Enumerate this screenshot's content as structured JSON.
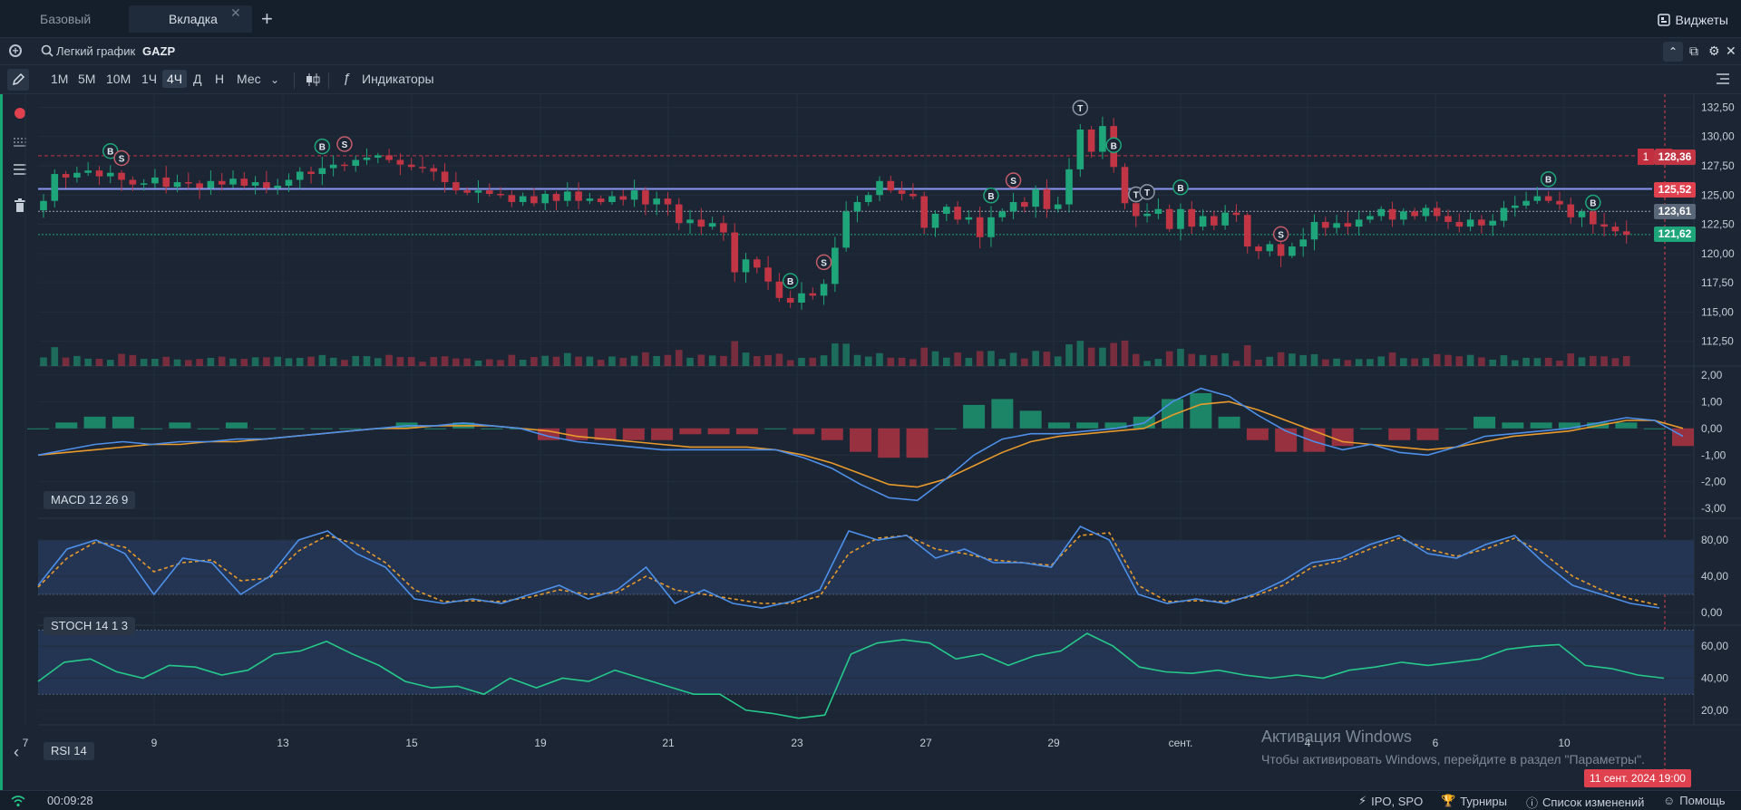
{
  "tabs": [
    {
      "label": "Базовый"
    },
    {
      "label": "Вкладка",
      "active": true
    }
  ],
  "tab_close_glyph": "✕",
  "tab_add_glyph": "+",
  "widgets_label": "Виджеты",
  "search": {
    "chart_type": "Легкий график",
    "ticker": "GAZP"
  },
  "timeframes": [
    "1М",
    "5М",
    "10М",
    "1Ч",
    "4Ч",
    "Д",
    "Н",
    "Мес"
  ],
  "active_timeframe": "4Ч",
  "indicators_label": "Индикаторы",
  "indicator_labels": {
    "macd": "MACD 12 26 9",
    "stoch": "STOCH 14 1 3",
    "rsi": "RSI 14"
  },
  "price_tags": {
    "order": "128,36",
    "level": "125,52",
    "current": "123,61",
    "bid": "121,62"
  },
  "order_qty": "1",
  "date_flag": "11 сент. 2024 19:00",
  "watermark": {
    "title": "Активация Windows",
    "subtitle": "Чтобы активировать Windows, перейдите в раздел \"Параметры\"."
  },
  "status": {
    "clock": "00:09:28",
    "ipo": "IPO, SPO",
    "tournaments": "Турниры",
    "changelog": "Список изменений",
    "help": "Помощь"
  },
  "colors": {
    "up": "#1fa57a",
    "down": "#c23545",
    "macd": "#4e8fe8",
    "signal": "#e89a2c",
    "rsi": "#25c98a",
    "level": "#8a96f0",
    "band": "#233552"
  },
  "chart_data": [
    {
      "type": "candlestick",
      "ticker": "GAZP",
      "x_ticks": [
        "7",
        "9",
        "13",
        "15",
        "19",
        "21",
        "23",
        "27",
        "29",
        "сент.",
        "4",
        "6",
        "10"
      ],
      "y_ticks": [
        "132,50",
        "130,00",
        "127,50",
        "125,00",
        "122,50",
        "120,00",
        "117,50",
        "115,00",
        "112,50"
      ],
      "ylim": [
        111,
        133
      ],
      "close": [
        124.5,
        126.8,
        126.5,
        126.9,
        127.1,
        126.6,
        126.9,
        126.3,
        125.9,
        126.0,
        126.5,
        125.7,
        126.1,
        126.0,
        125.6,
        126.2,
        125.9,
        126.4,
        125.8,
        126.1,
        125.6,
        125.8,
        126.3,
        127.0,
        126.8,
        127.3,
        127.6,
        127.5,
        128.0,
        128.2,
        128.4,
        128.0,
        127.6,
        127.4,
        127.3,
        127.0,
        126.1,
        125.4,
        125.2,
        125.4,
        125.1,
        125.0,
        124.4,
        124.9,
        124.3,
        125.1,
        124.5,
        125.3,
        124.5,
        124.7,
        124.4,
        124.9,
        124.6,
        125.4,
        124.2,
        124.7,
        124.2,
        122.6,
        122.9,
        122.3,
        122.6,
        121.8,
        118.4,
        119.5,
        118.8,
        117.6,
        116.2,
        115.8,
        116.6,
        116.4,
        117.4,
        120.5,
        123.6,
        124.4,
        125.0,
        126.2,
        125.4,
        125.1,
        124.9,
        122.2,
        123.4,
        124.0,
        122.9,
        123.1,
        121.4,
        123.1,
        123.6,
        124.4,
        124.0,
        125.5,
        123.8,
        124.2,
        127.2,
        130.6,
        128.7,
        130.9,
        127.4,
        124.3,
        123.2,
        123.4,
        123.8,
        122.1,
        123.8,
        122.3,
        123.2,
        122.4,
        123.5,
        123.3,
        120.6,
        120.2,
        120.8,
        119.8,
        120.6,
        121.2,
        122.7,
        122.2,
        122.6,
        122.3,
        122.9,
        123.2,
        123.8,
        122.9,
        123.6,
        123.2,
        123.9,
        123.2,
        122.7,
        122.3,
        122.9,
        122.4,
        122.8,
        123.9,
        124.1,
        124.5,
        124.9,
        124.5,
        124.2,
        123.1,
        123.6,
        122.5,
        122.3,
        121.9,
        121.6
      ],
      "volume_shown": true,
      "price_lines": [
        "128,36",
        "125,52",
        "123,61",
        "121,62"
      ],
      "trade_marks": [
        {
          "label": "B",
          "i": 6
        },
        {
          "label": "S",
          "i": 7
        },
        {
          "label": "B",
          "i": 25
        },
        {
          "label": "S",
          "i": 27
        },
        {
          "label": "B",
          "i": 67
        },
        {
          "label": "S",
          "i": 70
        },
        {
          "label": "B",
          "i": 85
        },
        {
          "label": "S",
          "i": 87
        },
        {
          "label": "T",
          "i": 93
        },
        {
          "label": "B",
          "i": 96
        },
        {
          "label": "T",
          "i": 98
        },
        {
          "label": "T",
          "i": 99
        },
        {
          "label": "B",
          "i": 102
        },
        {
          "label": "S",
          "i": 111
        },
        {
          "label": "B",
          "i": 135
        },
        {
          "label": "B",
          "i": 139
        }
      ]
    },
    {
      "type": "line",
      "name": "MACD 12 26 9",
      "y_ticks": [
        "2,00",
        "1,00",
        "0,00",
        "-1,00",
        "-2,00",
        "-3,00"
      ],
      "ylim": [
        -3.3,
        2.2
      ],
      "macd": [
        -1.0,
        -0.8,
        -0.6,
        -0.5,
        -0.6,
        -0.5,
        -0.5,
        -0.4,
        -0.4,
        -0.3,
        -0.2,
        -0.1,
        0,
        0.1,
        0.1,
        0.2,
        0.1,
        0,
        -0.3,
        -0.5,
        -0.6,
        -0.7,
        -0.8,
        -0.8,
        -0.8,
        -0.8,
        -0.8,
        -1.1,
        -1.5,
        -2.1,
        -2.6,
        -2.7,
        -1.9,
        -1.0,
        -0.4,
        -0.2,
        -0.2,
        -0.1,
        0,
        0.2,
        1.0,
        1.5,
        1.2,
        0.5,
        -0.1,
        -0.5,
        -0.8,
        -0.6,
        -0.9,
        -1.0,
        -0.7,
        -0.3,
        -0.2,
        -0.1,
        0,
        0.2,
        0.4,
        0.3,
        -0.3
      ],
      "signal": [
        -1.0,
        -0.9,
        -0.8,
        -0.7,
        -0.6,
        -0.6,
        -0.5,
        -0.5,
        -0.4,
        -0.3,
        -0.2,
        -0.1,
        0,
        0,
        0.1,
        0.1,
        0.1,
        0,
        -0.1,
        -0.3,
        -0.4,
        -0.5,
        -0.6,
        -0.7,
        -0.7,
        -0.7,
        -0.8,
        -1.0,
        -1.3,
        -1.7,
        -2.1,
        -2.2,
        -1.9,
        -1.4,
        -0.9,
        -0.5,
        -0.3,
        -0.2,
        -0.1,
        0,
        0.5,
        0.9,
        1.0,
        0.7,
        0.3,
        -0.1,
        -0.5,
        -0.6,
        -0.7,
        -0.8,
        -0.7,
        -0.5,
        -0.3,
        -0.2,
        -0.1,
        0.1,
        0.3,
        0.3,
        0
      ]
    },
    {
      "type": "line",
      "name": "STOCH 14 1 3",
      "y_ticks": [
        "80,00",
        "40,00",
        "0,00"
      ],
      "ylim": [
        -12,
        100
      ],
      "bands": [
        20,
        80
      ],
      "k": [
        30,
        70,
        80,
        65,
        20,
        60,
        55,
        20,
        40,
        80,
        90,
        65,
        50,
        15,
        10,
        15,
        10,
        20,
        30,
        15,
        25,
        50,
        10,
        25,
        10,
        5,
        12,
        25,
        90,
        80,
        85,
        60,
        70,
        55,
        55,
        50,
        95,
        80,
        20,
        10,
        15,
        10,
        20,
        35,
        55,
        60,
        75,
        85,
        65,
        60,
        75,
        85,
        55,
        30,
        20,
        10,
        5
      ],
      "d": [
        28,
        60,
        78,
        72,
        45,
        55,
        58,
        35,
        38,
        68,
        85,
        75,
        55,
        25,
        12,
        13,
        12,
        17,
        25,
        20,
        22,
        40,
        25,
        20,
        15,
        10,
        10,
        18,
        65,
        82,
        85,
        70,
        65,
        58,
        55,
        52,
        85,
        88,
        30,
        12,
        13,
        12,
        18,
        30,
        50,
        57,
        70,
        82,
        70,
        62,
        70,
        82,
        65,
        40,
        25,
        15,
        8
      ]
    },
    {
      "type": "line",
      "name": "RSI 14",
      "y_ticks": [
        "60,00",
        "40,00",
        "20,00"
      ],
      "ylim": [
        12,
        72
      ],
      "bands": [
        30,
        70
      ],
      "values": [
        38,
        50,
        52,
        44,
        40,
        48,
        47,
        42,
        45,
        55,
        57,
        63,
        55,
        48,
        38,
        34,
        35,
        30,
        40,
        34,
        40,
        38,
        45,
        40,
        35,
        30,
        30,
        20,
        18,
        15,
        17,
        55,
        62,
        64,
        62,
        52,
        55,
        48,
        54,
        57,
        68,
        60,
        47,
        44,
        43,
        45,
        42,
        40,
        42,
        40,
        45,
        47,
        50,
        48,
        50,
        52,
        58,
        60,
        61,
        48,
        46,
        42,
        40
      ]
    }
  ]
}
